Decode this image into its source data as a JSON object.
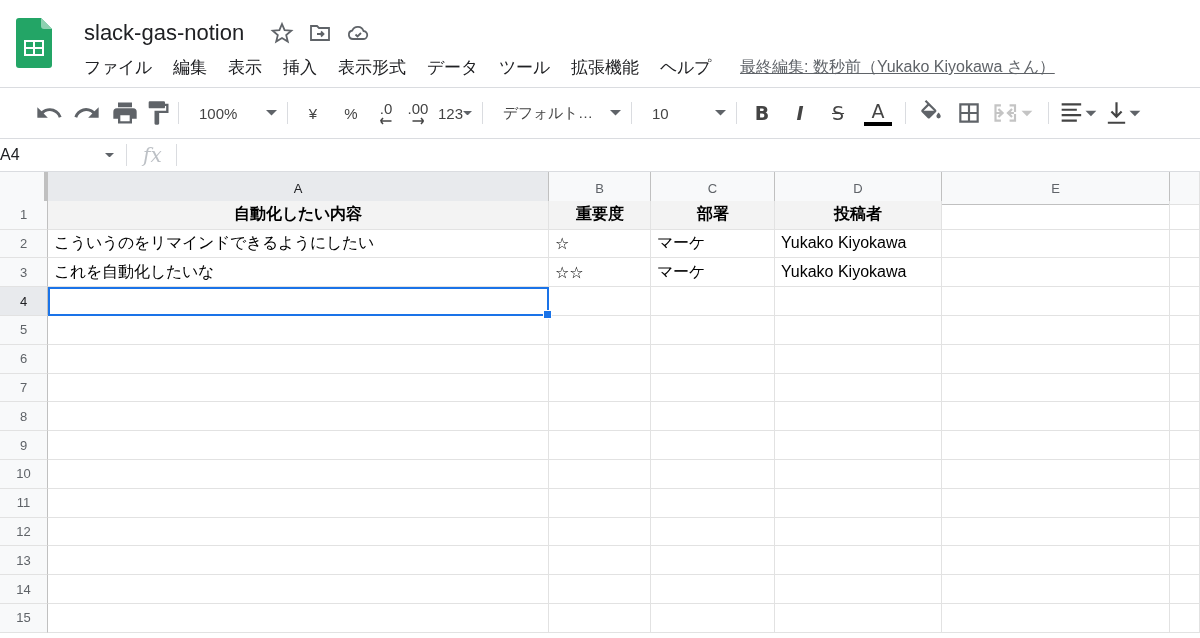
{
  "document": {
    "title": "slack-gas-notion"
  },
  "menu": [
    "ファイル",
    "編集",
    "表示",
    "挿入",
    "表示形式",
    "データ",
    "ツール",
    "拡張機能",
    "ヘルプ"
  ],
  "last_edit": "最終編集: 数秒前（Yukako Kiyokawa さん）",
  "toolbar": {
    "zoom": "100%",
    "currency": "¥",
    "percent": "%",
    "decrease_decimal": ".0",
    "increase_decimal": ".00",
    "more_formats": "123",
    "font": "デフォルト…",
    "font_size": "10",
    "bold": "B",
    "italic": "I",
    "strikethrough": "S",
    "text_color": "A",
    "merge_disabled": true
  },
  "formula_bar": {
    "name_box": "A4",
    "fx": "fx"
  },
  "columns": [
    {
      "label": "A",
      "selected": true
    },
    {
      "label": "B",
      "selected": false
    },
    {
      "label": "C",
      "selected": false
    },
    {
      "label": "D",
      "selected": false
    },
    {
      "label": "E",
      "selected": false
    }
  ],
  "header_row": {
    "number": "1",
    "cells": [
      "自動化したい内容",
      "重要度",
      "部署",
      "投稿者",
      ""
    ]
  },
  "rows": [
    {
      "number": "2",
      "selected": false,
      "cells": [
        "こういうのをリマインドできるようにしたい",
        "☆",
        "マーケ",
        "Yukako Kiyokawa",
        ""
      ]
    },
    {
      "number": "3",
      "selected": false,
      "cells": [
        "これを自動化したいな",
        "☆☆",
        "マーケ",
        "Yukako Kiyokawa",
        ""
      ]
    },
    {
      "number": "4",
      "selected": true,
      "cells": [
        "",
        "",
        "",
        "",
        ""
      ]
    },
    {
      "number": "5",
      "selected": false,
      "cells": [
        "",
        "",
        "",
        "",
        ""
      ]
    },
    {
      "number": "6",
      "selected": false,
      "cells": [
        "",
        "",
        "",
        "",
        ""
      ]
    },
    {
      "number": "7",
      "selected": false,
      "cells": [
        "",
        "",
        "",
        "",
        ""
      ]
    },
    {
      "number": "8",
      "selected": false,
      "cells": [
        "",
        "",
        "",
        "",
        ""
      ]
    },
    {
      "number": "9",
      "selected": false,
      "cells": [
        "",
        "",
        "",
        "",
        ""
      ]
    },
    {
      "number": "10",
      "selected": false,
      "cells": [
        "",
        "",
        "",
        "",
        ""
      ]
    },
    {
      "number": "11",
      "selected": false,
      "cells": [
        "",
        "",
        "",
        "",
        ""
      ]
    },
    {
      "number": "12",
      "selected": false,
      "cells": [
        "",
        "",
        "",
        "",
        ""
      ]
    },
    {
      "number": "13",
      "selected": false,
      "cells": [
        "",
        "",
        "",
        "",
        ""
      ]
    },
    {
      "number": "14",
      "selected": false,
      "cells": [
        "",
        "",
        "",
        "",
        ""
      ]
    },
    {
      "number": "15",
      "selected": false,
      "cells": [
        "",
        "",
        "",
        "",
        ""
      ]
    }
  ]
}
